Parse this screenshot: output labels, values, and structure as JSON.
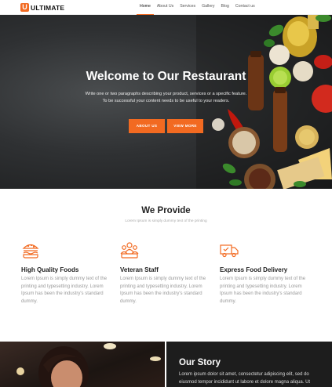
{
  "brand": {
    "mark": "U",
    "name": "ULTIMATE"
  },
  "nav": {
    "items": [
      "Home",
      "About Us",
      "Services",
      "Gallery",
      "Blog",
      "Contact us"
    ],
    "active": "Home"
  },
  "hero": {
    "title": "Welcome to Our Restaurant",
    "subtitle_line1": "Write one or two paragraphs describing your product, services or a specific feature.",
    "subtitle_line2": "To be successful your content needs to be useful to your readers.",
    "btn_about": "ABOUT US",
    "btn_more": "VIEW MORE"
  },
  "provide": {
    "title": "We Provide",
    "subtitle": "Lorem Ipsum is simply dummy text of the printing",
    "services": [
      {
        "icon": "burger-icon",
        "title": "High Quality Foods",
        "text": "Lorem Ipsum is simply dummy text of the printing and typesetting industry. Lorem Ipsum has been the industry's standard dummy."
      },
      {
        "icon": "staff-icon",
        "title": "Veteran Staff",
        "text": "Lorem Ipsum is simply dummy text of the printing and typesetting industry. Lorem Ipsum has been the industry's standard dummy."
      },
      {
        "icon": "delivery-truck-icon",
        "title": "Express Food Delivery",
        "text": "Lorem Ipsum is simply dummy text of the printing and typesetting industry. Lorem Ipsum has been the industry's standard dummy."
      }
    ]
  },
  "story": {
    "title": "Our Story",
    "text": "Lorem ipsum dolor sit amet, consectetur adipiscing elit, sed do eiusmod tempor incididunt ut labore et dolore magna aliqua. Ut"
  },
  "colors": {
    "accent": "#f26a21",
    "dark": "#1d1d1d"
  }
}
